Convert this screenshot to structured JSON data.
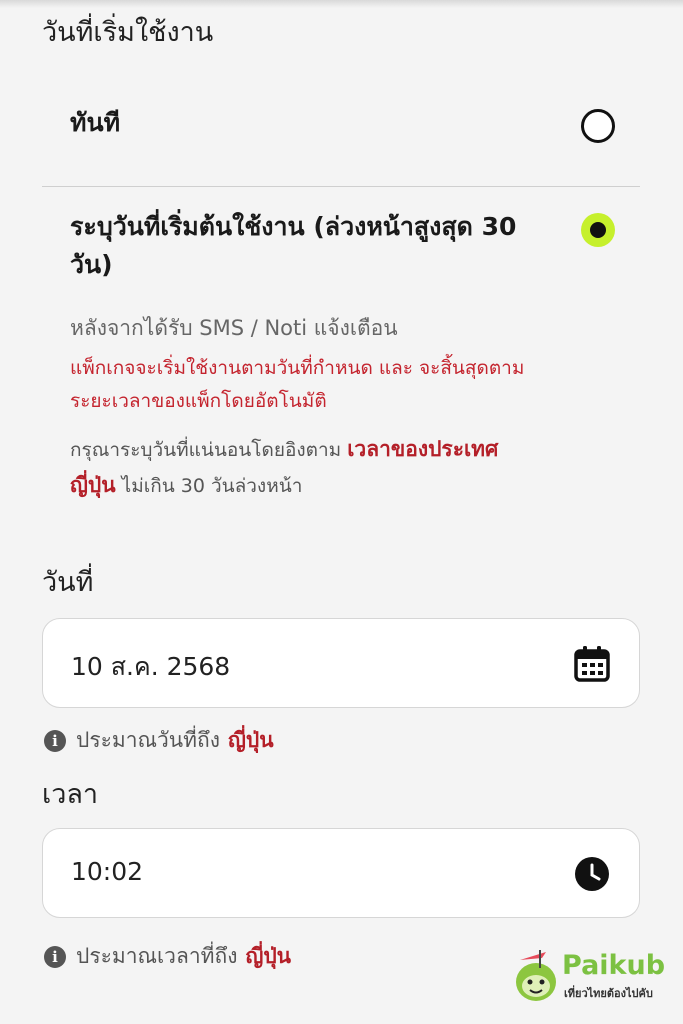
{
  "section_title": "วันที่เริ่มใช้งาน",
  "options": [
    {
      "label": "ทันที",
      "selected": false
    },
    {
      "label_line1": "ระบุวันที่เริ่มต้นใช้งาน (ล่วงหน้าสูงสุด 30",
      "label_line2": "วัน)",
      "selected": true
    }
  ],
  "description": {
    "gray": "หลังจากได้รับ SMS / Noti แจ้งเตือน",
    "red_line1": "แพ็กเกจจะเริ่มใช้งานตามวันที่กำหนด และ จะสิ้นสุดตาม",
    "red_line2": "ระยะเวลาของแพ็กโดยอัตโนมัติ",
    "note_prefix": "กรุณาระบุวันที่แน่นอนโดยอิงตาม",
    "note_highlight1": "เวลาของประเทศ",
    "note_highlight2": "ญี่ปุ่น",
    "note_suffix": "ไม่เกิน 30 วันล่วงหน้า"
  },
  "date_field": {
    "label": "วันที่",
    "value": "10 ส.ค. 2568",
    "icon": "calendar-icon",
    "hint": "ประมาณวันที่ถึง",
    "hint_highlight": "ญี่ปุ่น"
  },
  "time_field": {
    "label": "เวลา",
    "value": "10:02",
    "icon": "clock-icon",
    "hint": "ประมาณเวลาที่ถึง",
    "hint_highlight": "ญี่ปุ่น"
  },
  "logo": {
    "name": "Paikub",
    "tagline": "เที่ยวไทยต้องไปคับ"
  },
  "colors": {
    "accent_green": "#c6f02c",
    "highlight_red": "#b41f28",
    "logo_green": "#7cc142"
  }
}
